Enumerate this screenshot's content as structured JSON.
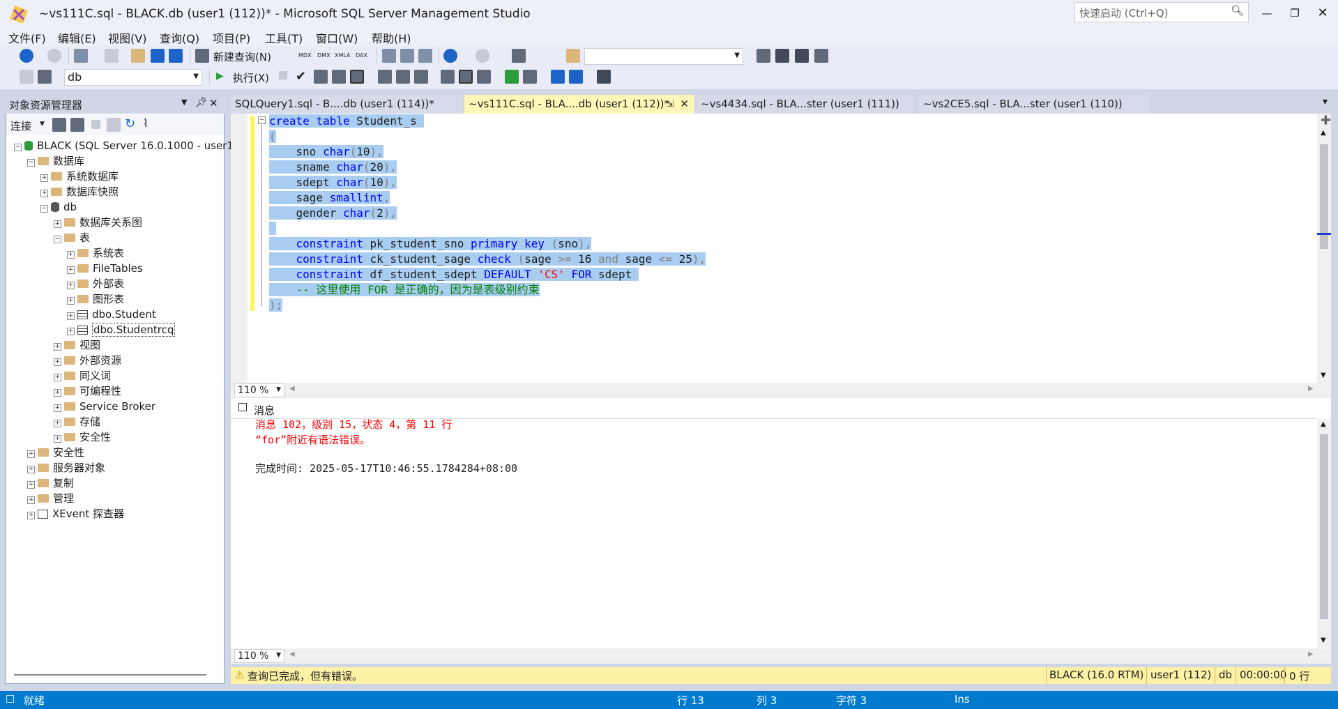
{
  "window": {
    "title": "~vs111C.sql - BLACK.db (user1 (112))* - Microsoft SQL Server Management Studio",
    "quick_launch_placeholder": "快速启动 (Ctrl+Q)"
  },
  "menu": [
    "文件(F)",
    "编辑(E)",
    "视图(V)",
    "查询(Q)",
    "项目(P)",
    "工具(T)",
    "窗口(W)",
    "帮助(H)"
  ],
  "toolbar": {
    "new_query": "新建查询(N)",
    "db_combo": "db",
    "execute": "执行(X)",
    "icon_labels": [
      "MDX",
      "DMX",
      "XMLA",
      "DAX"
    ]
  },
  "object_explorer": {
    "title": "对象资源管理器",
    "connect": "连接",
    "tree": [
      {
        "label": "BLACK (SQL Server 16.0.1000 - user1",
        "level": 0,
        "expander": "−",
        "icon": "server"
      },
      {
        "label": "数据库",
        "level": 1,
        "expander": "−",
        "icon": "folder"
      },
      {
        "label": "系统数据库",
        "level": 2,
        "expander": "+",
        "icon": "folder"
      },
      {
        "label": "数据库快照",
        "level": 2,
        "expander": "+",
        "icon": "folder"
      },
      {
        "label": "db",
        "level": 2,
        "expander": "−",
        "icon": "database"
      },
      {
        "label": "数据库关系图",
        "level": 3,
        "expander": "+",
        "icon": "folder"
      },
      {
        "label": "表",
        "level": 3,
        "expander": "−",
        "icon": "folder"
      },
      {
        "label": "系统表",
        "level": 4,
        "expander": "+",
        "icon": "folder"
      },
      {
        "label": "FileTables",
        "level": 4,
        "expander": "+",
        "icon": "folder"
      },
      {
        "label": "外部表",
        "level": 4,
        "expander": "+",
        "icon": "folder"
      },
      {
        "label": "图形表",
        "level": 4,
        "expander": "+",
        "icon": "folder"
      },
      {
        "label": "dbo.Student",
        "level": 4,
        "expander": "+",
        "icon": "table"
      },
      {
        "label": "dbo.Studentrcq",
        "level": 4,
        "expander": "+",
        "icon": "table"
      },
      {
        "label": "视图",
        "level": 3,
        "expander": "+",
        "icon": "folder"
      },
      {
        "label": "外部资源",
        "level": 3,
        "expander": "+",
        "icon": "folder"
      },
      {
        "label": "同义词",
        "level": 3,
        "expander": "+",
        "icon": "folder"
      },
      {
        "label": "可编程性",
        "level": 3,
        "expander": "+",
        "icon": "folder"
      },
      {
        "label": "Service Broker",
        "level": 3,
        "expander": "+",
        "icon": "folder"
      },
      {
        "label": "存储",
        "level": 3,
        "expander": "+",
        "icon": "folder"
      },
      {
        "label": "安全性",
        "level": 3,
        "expander": "+",
        "icon": "folder"
      },
      {
        "label": "安全性",
        "level": 1,
        "expander": "+",
        "icon": "folder"
      },
      {
        "label": "服务器对象",
        "level": 1,
        "expander": "+",
        "icon": "folder"
      },
      {
        "label": "复制",
        "level": 1,
        "expander": "+",
        "icon": "folder"
      },
      {
        "label": "管理",
        "level": 1,
        "expander": "+",
        "icon": "folder"
      },
      {
        "label": "XEvent 探查器",
        "level": 1,
        "expander": "+",
        "icon": "xevent"
      }
    ]
  },
  "tabs": [
    {
      "label": "SQLQuery1.sql - B....db (user1 (114))*",
      "active": false
    },
    {
      "label": "~vs111C.sql - BLA....db (user1 (112))*",
      "active": true
    },
    {
      "label": "~vs4434.sql - BLA...ster (user1 (111))",
      "active": false
    },
    {
      "label": "~vs2CE5.sql - BLA...ster (user1 (110))",
      "active": false
    }
  ],
  "editor": {
    "lines": [
      [
        {
          "t": "create",
          "c": "kw"
        },
        {
          "t": " "
        },
        {
          "t": "table",
          "c": "kw"
        },
        {
          "t": " Student_s "
        }
      ],
      [
        {
          "t": "(",
          "c": "gr"
        }
      ],
      [
        {
          "t": "    sno "
        },
        {
          "t": "char",
          "c": "kw"
        },
        {
          "t": "(",
          "c": "gr"
        },
        {
          "t": "10"
        },
        {
          "t": "),",
          "c": "gr"
        }
      ],
      [
        {
          "t": "    sname "
        },
        {
          "t": "char",
          "c": "kw"
        },
        {
          "t": "(",
          "c": "gr"
        },
        {
          "t": "20"
        },
        {
          "t": "),",
          "c": "gr"
        }
      ],
      [
        {
          "t": "    sdept "
        },
        {
          "t": "char",
          "c": "kw"
        },
        {
          "t": "(",
          "c": "gr"
        },
        {
          "t": "10"
        },
        {
          "t": "),",
          "c": "gr"
        }
      ],
      [
        {
          "t": "    sage "
        },
        {
          "t": "smallint",
          "c": "kw"
        },
        {
          "t": ",",
          "c": "gr"
        }
      ],
      [
        {
          "t": "    gender "
        },
        {
          "t": "char",
          "c": "kw"
        },
        {
          "t": "(",
          "c": "gr"
        },
        {
          "t": "2"
        },
        {
          "t": "),",
          "c": "gr"
        }
      ],
      [
        {
          "t": " "
        }
      ],
      [
        {
          "t": "    "
        },
        {
          "t": "constraint",
          "c": "kw"
        },
        {
          "t": " pk_student_sno "
        },
        {
          "t": "primary key",
          "c": "kw"
        },
        {
          "t": " "
        },
        {
          "t": "(",
          "c": "gr"
        },
        {
          "t": "sno"
        },
        {
          "t": "),",
          "c": "gr"
        }
      ],
      [
        {
          "t": "    "
        },
        {
          "t": "constraint",
          "c": "kw"
        },
        {
          "t": " ck_student_sage "
        },
        {
          "t": "check",
          "c": "kw"
        },
        {
          "t": " "
        },
        {
          "t": "(",
          "c": "gr"
        },
        {
          "t": "sage "
        },
        {
          "t": ">=",
          "c": "gr"
        },
        {
          "t": " 16 "
        },
        {
          "t": "and",
          "c": "gr"
        },
        {
          "t": " sage "
        },
        {
          "t": "<=",
          "c": "gr"
        },
        {
          "t": " 25"
        },
        {
          "t": "),",
          "c": "gr"
        }
      ],
      [
        {
          "t": "    "
        },
        {
          "t": "constraint",
          "c": "kw"
        },
        {
          "t": " df_student_sdept "
        },
        {
          "t": "DEFAULT",
          "c": "kw"
        },
        {
          "t": " "
        },
        {
          "t": "'CS'",
          "c": "st"
        },
        {
          "t": " "
        },
        {
          "t": "FOR",
          "c": "kw"
        },
        {
          "t": " sdept "
        }
      ],
      [
        {
          "t": "    "
        },
        {
          "t": "-- 这里使用 FOR 是正确的，因为是表级别约束",
          "c": "cm"
        }
      ],
      [
        {
          "t": ");",
          "c": "gr"
        }
      ]
    ],
    "zoom": "110 %"
  },
  "results": {
    "tab_label": "消息",
    "error_line1": "消息 102，级别 15，状态 4，第 11 行",
    "error_line2": "“for”附近有语法错误。",
    "completion": "完成时间: 2025-05-17T10:46:55.1784284+08:00",
    "zoom": "110 %"
  },
  "query_status": {
    "message": "查询已完成，但有错误。",
    "server": "BLACK (16.0 RTM)",
    "user": "user1 (112)",
    "db": "db",
    "time": "00:00:00",
    "rows": "0 行"
  },
  "statusbar": {
    "ready": "就绪",
    "row": "行 13",
    "col": "列 3",
    "char": "字符 3",
    "ins": "Ins"
  },
  "colors": {
    "accent": "#007acc",
    "selection": "#a8cdf1",
    "error": "#ff0000",
    "status_warning_bg": "#fdf1a6"
  }
}
